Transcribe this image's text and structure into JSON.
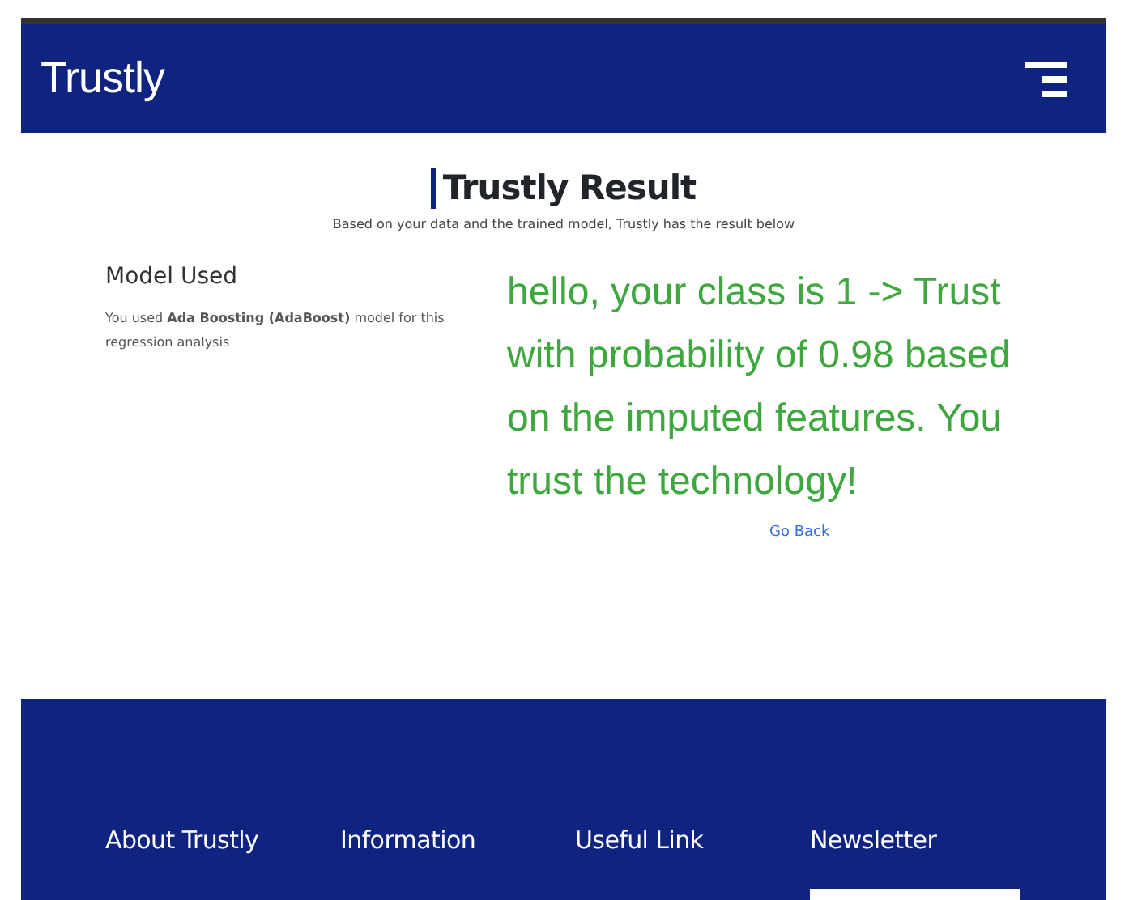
{
  "navbar": {
    "brand": "Trustly"
  },
  "header": {
    "title": "Trustly Result",
    "subtitle": "Based on your data and the trained model, Trustly has the result below"
  },
  "model": {
    "heading": "Model Used",
    "text": "You used **Ada Boosting (AdaBoost)** model for this regression analysis"
  },
  "result": {
    "text": "hello, your class is 1 -> Trust with probability of 0.98 based on the imputed features. You trust the technology!",
    "link": "Go Back"
  },
  "footer": {
    "columns": [
      {
        "heading": "About Trustly"
      },
      {
        "heading": "Information"
      },
      {
        "heading": "Useful Link"
      },
      {
        "heading": "Newsletter",
        "kind": "newsletter"
      }
    ]
  }
}
